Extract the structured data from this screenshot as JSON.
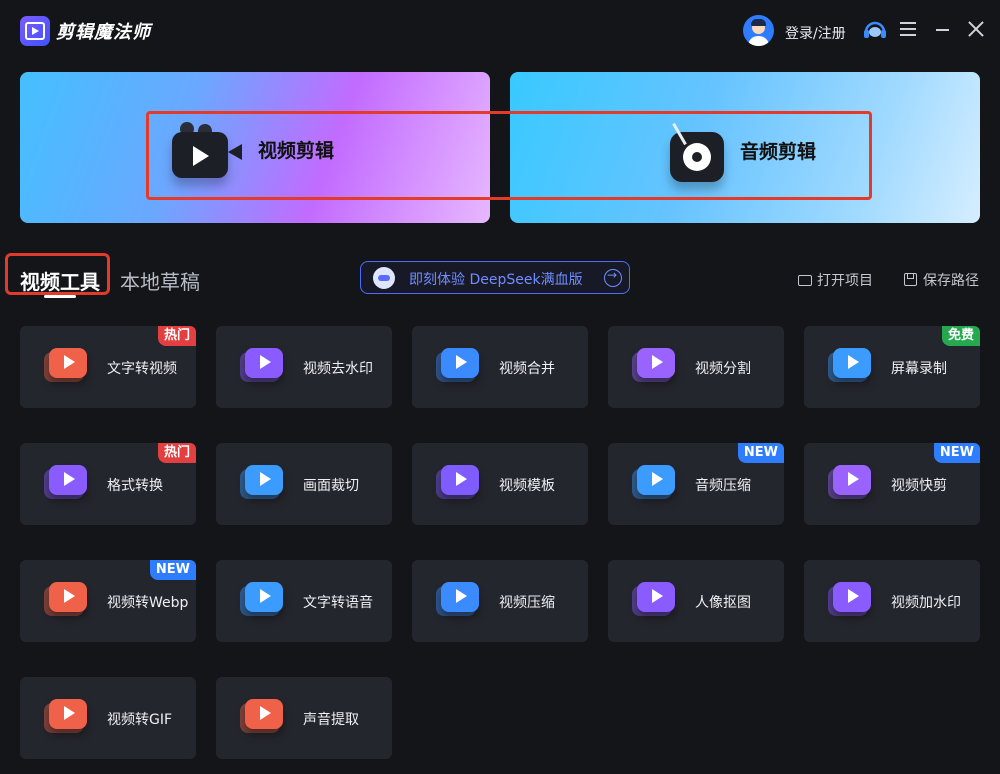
{
  "app": {
    "title": "剪辑魔法师"
  },
  "header": {
    "login_label": "登录/注册"
  },
  "hero": {
    "video_label": "视频剪辑",
    "audio_label": "音频剪辑"
  },
  "tabs": {
    "active": "视频工具",
    "inactive": "本地草稿"
  },
  "promo": {
    "label": "即刻体验 DeepSeek满血版"
  },
  "actions": {
    "open_project": "打开项目",
    "save_path": "保存路径"
  },
  "tools": [
    {
      "label": "文字转视频",
      "badge": "热门",
      "icon": "text-to-video-icon",
      "color": "#f0614a"
    },
    {
      "label": "视频去水印",
      "badge": "",
      "icon": "remove-watermark-icon",
      "color": "#8a5cff"
    },
    {
      "label": "视频合并",
      "badge": "",
      "icon": "merge-video-icon",
      "color": "#3b8bff"
    },
    {
      "label": "视频分割",
      "badge": "",
      "icon": "split-video-icon",
      "color": "#9a63ff"
    },
    {
      "label": "屏幕录制",
      "badge": "免费",
      "icon": "screen-record-icon",
      "color": "#3b9bff"
    },
    {
      "label": "格式转换",
      "badge": "热门",
      "icon": "format-convert-icon",
      "color": "#8a5cff"
    },
    {
      "label": "画面裁切",
      "badge": "",
      "icon": "crop-icon",
      "color": "#3b9bff"
    },
    {
      "label": "视频模板",
      "badge": "",
      "icon": "template-icon",
      "color": "#7f5cff"
    },
    {
      "label": "音频压缩",
      "badge": "NEW",
      "icon": "audio-compress-icon",
      "color": "#3b9bff"
    },
    {
      "label": "视频快剪",
      "badge": "NEW",
      "icon": "quick-cut-icon",
      "color": "#9a63ff"
    },
    {
      "label": "视频转Webp",
      "badge": "NEW",
      "icon": "video-to-webp-icon",
      "color": "#f0614a"
    },
    {
      "label": "文字转语音",
      "badge": "",
      "icon": "text-to-speech-icon",
      "color": "#3b9bff"
    },
    {
      "label": "视频压缩",
      "badge": "",
      "icon": "video-compress-icon",
      "color": "#3b8bff"
    },
    {
      "label": "人像抠图",
      "badge": "",
      "icon": "portrait-cutout-icon",
      "color": "#8a5cff"
    },
    {
      "label": "视频加水印",
      "badge": "",
      "icon": "add-watermark-icon",
      "color": "#8a5cff"
    },
    {
      "label": "视频转GIF",
      "badge": "",
      "icon": "video-to-gif-icon",
      "color": "#f0614a"
    },
    {
      "label": "声音提取",
      "badge": "",
      "icon": "audio-extract-icon",
      "color": "#f0614a"
    }
  ]
}
